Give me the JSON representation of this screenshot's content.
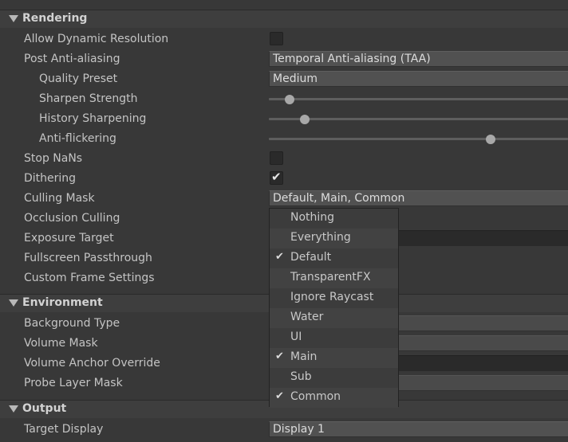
{
  "sections": {
    "rendering": "Rendering",
    "environment": "Environment",
    "output": "Output"
  },
  "rendering": {
    "allow_dynamic_resolution": {
      "label": "Allow Dynamic Resolution",
      "checked": false
    },
    "post_anti_aliasing": {
      "label": "Post Anti-aliasing",
      "value": "Temporal Anti-aliasing (TAA)"
    },
    "quality_preset": {
      "label": "Quality Preset",
      "value": "Medium"
    },
    "sharpen_strength": {
      "label": "Sharpen Strength",
      "level": 0.07
    },
    "history_sharpening": {
      "label": "History Sharpening",
      "level": 0.12
    },
    "anti_flickering": {
      "label": "Anti-flickering",
      "level": 0.74
    },
    "stop_nans": {
      "label": "Stop NaNs",
      "checked": false
    },
    "dithering": {
      "label": "Dithering",
      "checked": true,
      "check_glyph": "✔"
    },
    "culling_mask": {
      "label": "Culling Mask",
      "value": "Default, Main, Common"
    },
    "occlusion_culling": {
      "label": "Occlusion Culling"
    },
    "exposure_target": {
      "label": "Exposure Target"
    },
    "fullscreen_passthrough": {
      "label": "Fullscreen Passthrough"
    },
    "custom_frame_settings": {
      "label": "Custom Frame Settings"
    }
  },
  "environment": {
    "background_type": {
      "label": "Background Type"
    },
    "volume_mask": {
      "label": "Volume Mask"
    },
    "volume_anchor_override": {
      "label": "Volume Anchor Override"
    },
    "probe_layer_mask": {
      "label": "Probe Layer Mask"
    }
  },
  "output": {
    "target_display": {
      "label": "Target Display",
      "value": "Display 1"
    }
  },
  "culling_dropdown": {
    "check_glyph": "✔",
    "options": [
      {
        "label": "Nothing",
        "checked": false
      },
      {
        "label": "Everything",
        "checked": false
      },
      {
        "label": "Default",
        "checked": true
      },
      {
        "label": "TransparentFX",
        "checked": false
      },
      {
        "label": "Ignore Raycast",
        "checked": false
      },
      {
        "label": "Water",
        "checked": false
      },
      {
        "label": "UI",
        "checked": false
      },
      {
        "label": "Main",
        "checked": true
      },
      {
        "label": "Sub",
        "checked": false
      },
      {
        "label": "Common",
        "checked": true
      }
    ]
  },
  "colors": {
    "background": "#383838",
    "field": "#515151",
    "dropdown": "#3c3c3c"
  }
}
